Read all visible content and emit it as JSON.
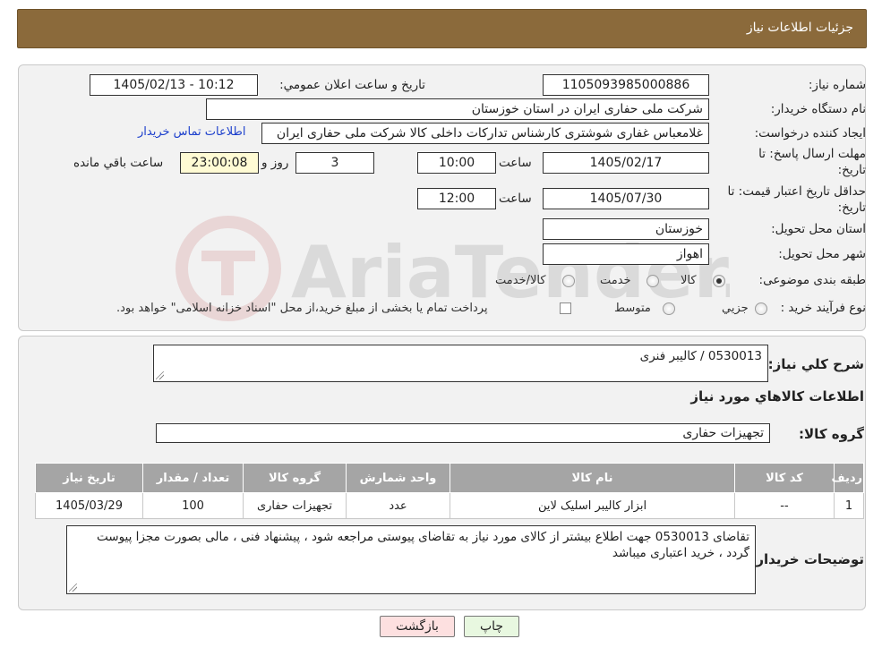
{
  "header": {
    "title": "جزئیات اطلاعات نیاز"
  },
  "form": {
    "need_number": {
      "label": "شماره نیاز:",
      "value": "1105093985000886"
    },
    "announce_datetime": {
      "label": "تاریخ و ساعت اعلان عمومي:",
      "value": "1405/02/13 - 10:12"
    },
    "buyer_org": {
      "label": "نام دستگاه خريدار:",
      "value": "شرکت ملی حفاری ایران در استان خوزستان"
    },
    "requester": {
      "label": "ايجاد کننده درخواست:",
      "value": "غلامعباس غفاری شوشتری کارشناس تدارکات داخلی کالا شرکت ملی حفاری ایران",
      "contact_link": "اطلاعات تماس خريدار"
    },
    "reply_deadline": {
      "label_line1": "مهلت ارسال پاسخ: تا",
      "label_line2": "تاريخ:",
      "date": "1405/02/17",
      "time_label": "ساعت",
      "time": "10:00",
      "days": "3",
      "days_label": "روز و",
      "remaining": "23:00:08",
      "remaining_label": "ساعت باقي مانده"
    },
    "price_validity": {
      "label_line1": "حداقل تاريخ اعتبار قيمت: تا",
      "label_line2": "تاريخ:",
      "date": "1405/07/30",
      "time_label": "ساعت",
      "time": "12:00"
    },
    "delivery_province": {
      "label": "استان محل تحويل:",
      "value": "خوزستان"
    },
    "delivery_city": {
      "label": "شهر محل تحويل:",
      "value": "اهواز"
    },
    "category": {
      "label": "طبقه بندی موضوعی:",
      "options": [
        "کالا",
        "خدمت",
        "کالا/خدمت"
      ],
      "selected": "کالا"
    },
    "purchase_process": {
      "label": "نوع فرآيند خريد :",
      "options": [
        "جزيي",
        "متوسط"
      ],
      "note": "پرداخت تمام يا بخشی از مبلغ خريد،از محل \"اسناد خزانه اسلامی\" خواهد بود."
    }
  },
  "need_summary": {
    "label": "شرح کلي نياز:",
    "value": "0530013  /  کالیبر فنری"
  },
  "goods_info": {
    "title": "اطلاعات کالاهاي مورد نياز",
    "group_label": "گروه کالا:",
    "group_value": "تجهیزات حفاری",
    "table": {
      "headers": [
        "رديف",
        "کد کالا",
        "نام کالا",
        "واحد شمارش",
        "گروه کالا",
        "تعداد / مقدار",
        "تاريخ نياز"
      ],
      "rows": [
        [
          "1",
          "--",
          "ابزار کالیبر اسلیک لاین",
          "عدد",
          "تجهیزات حفاری",
          "100",
          "1405/03/29"
        ]
      ]
    }
  },
  "buyer_notes": {
    "label": "توضيحات خريدار:",
    "value": "تقاضای  0530013 جهت اطلاع بیشتر از کالای مورد نیاز به تقاضای پیوستی مراجعه شود ، پیشنهاد فنی ، مالی بصورت مجزا پیوست گردد ، خرید اعتباری میباشد"
  },
  "buttons": {
    "print": "چاپ",
    "back": "بازگشت"
  },
  "watermark": {
    "text": "AriaTender.neT"
  },
  "colors": {
    "header_bg": "#8b6a3b",
    "link": "#1c3fcc",
    "back_button_bg": "#fde0e0",
    "print_button_bg": "#e8f8e0",
    "table_header_bg": "#a5a5a5"
  }
}
